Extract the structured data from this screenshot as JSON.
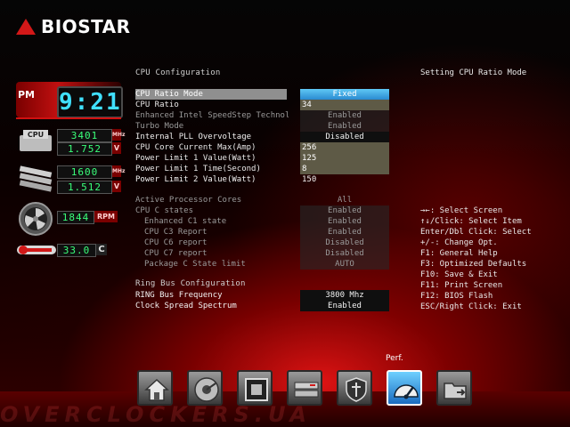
{
  "brand": {
    "logo_text": "BIOSTAR",
    "watermark": "OVERCLOCKERS.UA"
  },
  "status": {
    "ampm": "PM",
    "time": "9:21",
    "cpu_label": "CPU",
    "cpu_freq": "3401",
    "cpu_freq_unit": "MHz",
    "cpu_volt": "1.752",
    "cpu_volt_unit": "V",
    "mem_freq": "1600",
    "mem_freq_unit": "MHz",
    "mem_volt": "1.512",
    "mem_volt_unit": "V",
    "fan_rpm": "1844",
    "fan_unit": "RPM",
    "temp": "33.0",
    "temp_unit": "C"
  },
  "main": {
    "section_title": "CPU Configuration",
    "rows": [
      {
        "label": "CPU Ratio Mode",
        "value": "Fixed",
        "state": "sel"
      },
      {
        "label": "CPU Ratio",
        "value": "34",
        "state": "ed"
      },
      {
        "label": "Enhanced Intel SpeedStep Technolog",
        "value": "Enabled",
        "state": "dim"
      },
      {
        "label": "Turbo Mode",
        "value": "Enabled",
        "state": "dim"
      },
      {
        "label": "Internal PLL Overvoltage",
        "value": "Disabled",
        "state": "en"
      },
      {
        "label": "CPU Core Current Max(Amp)",
        "value": "256",
        "state": "ed"
      },
      {
        "label": "Power Limit 1 Value(Watt)",
        "value": "125",
        "state": "ed"
      },
      {
        "label": "Power Limit 1 Time(Second)",
        "value": "8",
        "state": "ed"
      },
      {
        "label": "Power Limit 2 Value(Watt)",
        "value": "150",
        "state": "plain"
      }
    ],
    "rows2": [
      {
        "label": "Active Processor Cores",
        "value": "All",
        "state": "dimnobg"
      },
      {
        "label": "CPU C states",
        "value": "Enabled",
        "state": "dim"
      },
      {
        "label": "Enhanced C1 state",
        "value": "Enabled",
        "state": "dim sub"
      },
      {
        "label": "CPU C3 Report",
        "value": "Enabled",
        "state": "dim sub"
      },
      {
        "label": "CPU C6 report",
        "value": "Disabled",
        "state": "dim sub"
      },
      {
        "label": "CPU C7 report",
        "value": "Disabled",
        "state": "dim sub"
      },
      {
        "label": "Package C State limit",
        "value": "AUTO",
        "state": "dim sub"
      }
    ],
    "ring_title": "Ring Bus Configuration",
    "rows3": [
      {
        "label": "RING Bus Frequency",
        "value": "3800 Mhz",
        "state": "en"
      },
      {
        "label": "Clock Spread Spectrum",
        "value": "Enabled",
        "state": "en"
      }
    ]
  },
  "help": {
    "title": "Setting CPU Ratio Mode",
    "keys": [
      "→←: Select Screen",
      "↑↓/Click: Select Item",
      "Enter/Dbl Click: Select",
      "+/-: Change Opt.",
      "F1: General Help",
      "F3: Optimized Defaults",
      "F10: Save & Exit",
      "F11: Print Screen",
      "F12: BIOS Flash",
      "ESC/Right Click: Exit"
    ]
  },
  "toolbar": {
    "active_label": "Perf.",
    "items": [
      "home-icon",
      "disk-icon",
      "chip-icon",
      "drives-icon",
      "shield-icon",
      "gauge-icon",
      "folder-icon"
    ]
  }
}
